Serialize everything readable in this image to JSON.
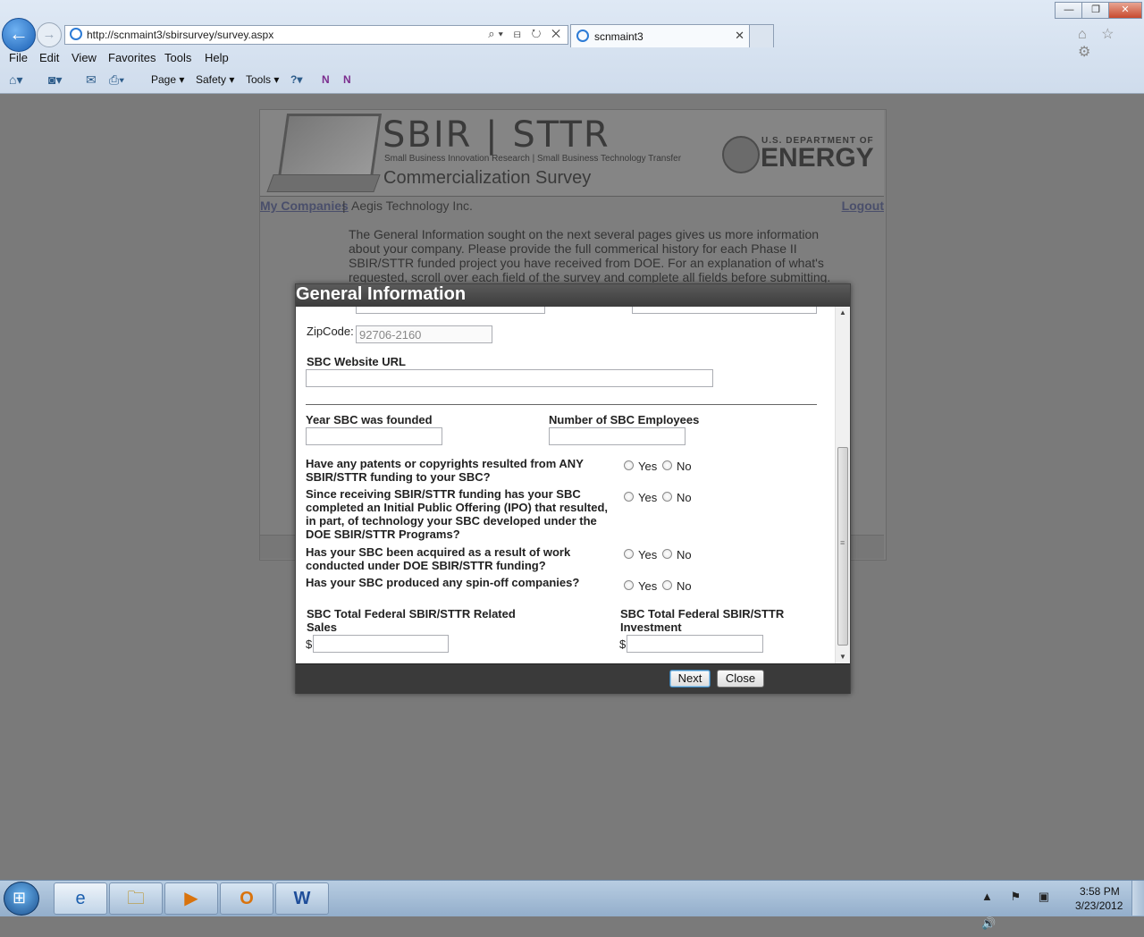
{
  "browser": {
    "url": "http://scnmaint3/sbirsurvey/survey.aspx",
    "tab_title": "scnmaint3",
    "tab_close": "✕",
    "back_glyph": "←",
    "forward_glyph": "→",
    "address_icons": "⌕▾ ⊟ ↻ ✕",
    "right_icons": "⌂ ☆ ⚙",
    "window_controls": {
      "minimize": "—",
      "restore": "❐",
      "close": "✕"
    },
    "menu": [
      "File",
      "Edit",
      "View",
      "Favorites",
      "Tools",
      "Help"
    ],
    "command_bar": {
      "page": "Page ▾",
      "safety": "Safety ▾",
      "tools": "Tools ▾",
      "help": "?▾",
      "onenote1": "N",
      "onenote2": "N"
    }
  },
  "page": {
    "brand_title": "SBIR | STTR",
    "brand_subtitle": "Small Business Innovation Research | Small Business Technology Transfer",
    "brand_survey": "Commercialization Survey",
    "doe_dept": "U.S. DEPARTMENT OF",
    "doe_energy": "ENERGY",
    "my_companies": "My Companies",
    "separator": "|",
    "company_name": "Aegis Technology Inc.",
    "logout": "Logout",
    "intro": "The General Information sought on the next several pages gives us more information about your company. Please provide the full commerical history for each Phase II SBIR/STTR funded project you have received from DOE. For an explanation of what's requested, scroll over each field of the survey and complete all fields before submitting."
  },
  "modal": {
    "title": "General Information",
    "zip_label": "ZipCode:",
    "zip_value": "92706-2160",
    "website_label": "SBC Website URL",
    "website_value": "",
    "year_label": "Year SBC was founded",
    "employees_label": "Number of SBC Employees",
    "questions": [
      {
        "text": "Have any patents or copyrights resulted from ANY SBIR/STTR funding to your SBC?",
        "yes": "Yes",
        "no": "No"
      },
      {
        "text": "Since receiving SBIR/STTR funding has your SBC completed an Initial Public Offering (IPO) that resulted, in part, of technology your SBC developed under the DOE SBIR/STTR Programs?",
        "yes": "Yes",
        "no": "No"
      },
      {
        "text": "Has your SBC been acquired as a result of work conducted under DOE SBIR/STTR funding?",
        "yes": "Yes",
        "no": "No"
      },
      {
        "text": "Has your SBC produced any spin-off companies?",
        "yes": "Yes",
        "no": "No"
      }
    ],
    "sales_label": "SBC Total Federal SBIR/STTR Related Sales",
    "investment_label": "SBC Total Federal SBIR/STTR Investment",
    "currency": "$",
    "next_label": "Next",
    "close_label": "Close",
    "scroll_up": "▲",
    "scroll_down": "▼",
    "scroll_grip": "≡"
  },
  "taskbar": {
    "start_glyph": "⊞",
    "apps": [
      "e",
      "🗀",
      "▶",
      "O",
      "W"
    ],
    "tray": "▲ ⚑ ▣ 🔊",
    "time": "3:58 PM",
    "date": "3/23/2012"
  }
}
